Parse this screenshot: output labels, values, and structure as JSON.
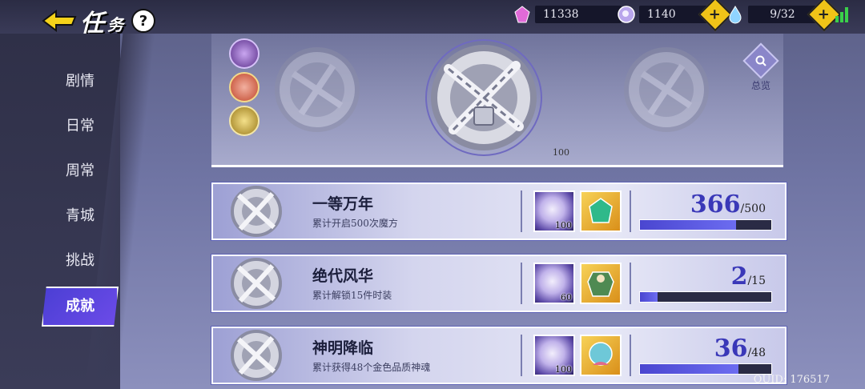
{
  "header": {
    "title": "任",
    "title_sub": "务",
    "help": "?"
  },
  "resources": [
    {
      "icon": "pink-gem-icon",
      "value": "11338",
      "color": "#e06ad8"
    },
    {
      "icon": "magic-orb-icon",
      "value": "1140",
      "color": "#b9a6ec"
    },
    {
      "icon": "water-drop-icon",
      "value": "9/32",
      "color": "#8fd4ff"
    }
  ],
  "sidebar": {
    "items": [
      {
        "label": "剧情"
      },
      {
        "label": "日常"
      },
      {
        "label": "周常"
      },
      {
        "label": "青城"
      },
      {
        "label": "挑战"
      },
      {
        "label": "成就",
        "active": true
      }
    ]
  },
  "banner": {
    "overview_label": "总览",
    "partial_qty": "100"
  },
  "achievements": [
    {
      "name": "一等万年",
      "desc": "累计开启500次魔方",
      "reward_qty": "100",
      "current": "366",
      "target": "/500",
      "progress": 0.732
    },
    {
      "name": "绝代风华",
      "desc": "累计解锁15件时装",
      "reward_qty": "60",
      "current": "2",
      "target": "/15",
      "progress": 0.133
    },
    {
      "name": "神明降临",
      "desc": "累计获得48个金色品质神魂",
      "reward_qty": "100",
      "current": "36",
      "target": "/48",
      "progress": 0.75
    }
  ],
  "footer": {
    "uid": "QUID: 176517"
  },
  "colors": {
    "accent": "#4b3fd4",
    "progress": "#4a46d0",
    "plus": "#f0c418"
  }
}
